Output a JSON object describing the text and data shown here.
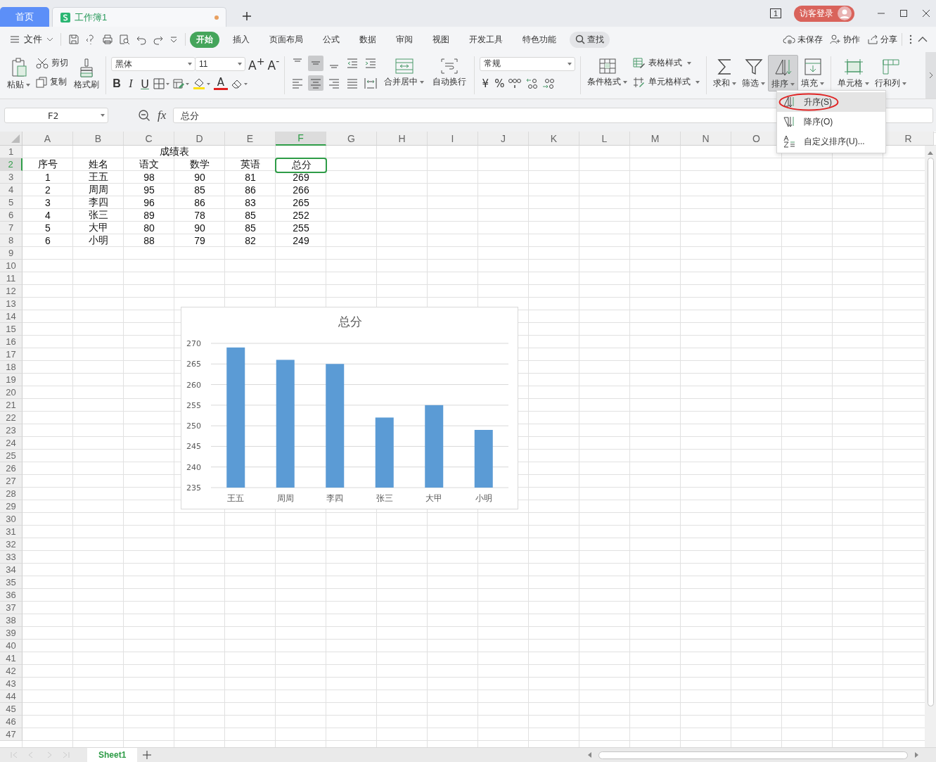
{
  "tabs": [
    {
      "label": "首页",
      "selected": false,
      "kind": "home",
      "unsaved": false
    },
    {
      "label": "工作簿1",
      "selected": true,
      "kind": "doc",
      "unsaved": true
    }
  ],
  "window_count": "1",
  "account": "访客登录",
  "menu": {
    "file": "文件",
    "tabs": [
      {
        "label": "开始",
        "selected": true
      },
      {
        "label": "插入",
        "selected": false
      },
      {
        "label": "页面布局",
        "selected": false
      },
      {
        "label": "公式",
        "selected": false
      },
      {
        "label": "数据",
        "selected": false
      },
      {
        "label": "审阅",
        "selected": false
      },
      {
        "label": "视图",
        "selected": false
      },
      {
        "label": "开发工具",
        "selected": false
      },
      {
        "label": "特色功能",
        "selected": false
      }
    ],
    "search": "查找",
    "actions": [
      "未保存",
      "协作",
      "分享"
    ]
  },
  "ribbon": {
    "paste": "粘贴",
    "cut": "剪切",
    "copy": "复制",
    "format_painter": "格式刷",
    "font": "黑体",
    "font_size": "11",
    "grow_font": "A$^{+}$",
    "shrink_font": "A$^{-}$",
    "bold": "B",
    "italic": "I",
    "underline": "U",
    "font_color": "A",
    "valign": [
      {
        "selected": false
      },
      {
        "selected": true
      },
      {
        "selected": false
      }
    ],
    "halign": [
      {
        "selected": false
      },
      {
        "selected": true
      },
      {
        "selected": false
      },
      {
        "selected": false
      }
    ],
    "merge_center": "合并居中",
    "wrap_text": "自动换行",
    "number_format": "常规",
    "currency": "¥",
    "percent": "%",
    "conditional_format": "条件格式",
    "table_style": "表格样式",
    "cell_style": "单元格样式",
    "sum": "求和",
    "filter": "筛选",
    "sort": {
      "label": "排序",
      "selected": true
    },
    "fill": "填充",
    "cell": "单元格",
    "rows_cols": "行和列"
  },
  "formula_bar": {
    "name_box": "F2",
    "fx": "fx",
    "formula": "总分"
  },
  "sheet": {
    "columns": [
      {
        "label": "A",
        "selected": false
      },
      {
        "label": "B",
        "selected": false
      },
      {
        "label": "C",
        "selected": false
      },
      {
        "label": "D",
        "selected": false
      },
      {
        "label": "E",
        "selected": false
      },
      {
        "label": "F",
        "selected": true
      },
      {
        "label": "G",
        "selected": false
      },
      {
        "label": "H",
        "selected": false
      },
      {
        "label": "I",
        "selected": false
      },
      {
        "label": "J",
        "selected": false
      },
      {
        "label": "K",
        "selected": false
      },
      {
        "label": "L",
        "selected": false
      },
      {
        "label": "M",
        "selected": false
      },
      {
        "label": "N",
        "selected": false
      },
      {
        "label": "O",
        "selected": false
      },
      {
        "label": "R",
        "selected": false
      }
    ],
    "row_numbers": [
      {
        "label": "1",
        "selected": false
      },
      {
        "label": "2",
        "selected": true
      },
      {
        "label": "3",
        "selected": false
      },
      {
        "label": "4",
        "selected": false
      },
      {
        "label": "5",
        "selected": false
      },
      {
        "label": "6",
        "selected": false
      },
      {
        "label": "7",
        "selected": false
      },
      {
        "label": "8",
        "selected": false
      },
      {
        "label": "9",
        "selected": false
      },
      {
        "label": "10",
        "selected": false
      },
      {
        "label": "11",
        "selected": false
      },
      {
        "label": "12",
        "selected": false
      },
      {
        "label": "13",
        "selected": false
      },
      {
        "label": "14",
        "selected": false
      },
      {
        "label": "15",
        "selected": false
      },
      {
        "label": "16",
        "selected": false
      },
      {
        "label": "17",
        "selected": false
      },
      {
        "label": "18",
        "selected": false
      },
      {
        "label": "19",
        "selected": false
      },
      {
        "label": "20",
        "selected": false
      },
      {
        "label": "21",
        "selected": false
      },
      {
        "label": "22",
        "selected": false
      },
      {
        "label": "23",
        "selected": false
      },
      {
        "label": "24",
        "selected": false
      },
      {
        "label": "25",
        "selected": false
      },
      {
        "label": "26",
        "selected": false
      },
      {
        "label": "27",
        "selected": false
      },
      {
        "label": "28",
        "selected": false
      },
      {
        "label": "29",
        "selected": false
      },
      {
        "label": "30",
        "selected": false
      },
      {
        "label": "31",
        "selected": false
      },
      {
        "label": "32",
        "selected": false
      },
      {
        "label": "33",
        "selected": false
      },
      {
        "label": "34",
        "selected": false
      },
      {
        "label": "35",
        "selected": false
      },
      {
        "label": "36",
        "selected": false
      },
      {
        "label": "37",
        "selected": false
      },
      {
        "label": "38",
        "selected": false
      },
      {
        "label": "39",
        "selected": false
      },
      {
        "label": "40",
        "selected": false
      },
      {
        "label": "41",
        "selected": false
      },
      {
        "label": "42",
        "selected": false
      },
      {
        "label": "43",
        "selected": false
      },
      {
        "label": "44",
        "selected": false
      },
      {
        "label": "45",
        "selected": false
      },
      {
        "label": "46",
        "selected": false
      },
      {
        "label": "47",
        "selected": false
      }
    ],
    "data": [
      {
        "kind": "title",
        "text": "成绩表"
      },
      {
        "kind": "cells",
        "cells": [
          {
            "text": "序号",
            "selected": false
          },
          {
            "text": "姓名",
            "selected": false
          },
          {
            "text": "语文",
            "selected": false
          },
          {
            "text": "数学",
            "selected": false
          },
          {
            "text": "英语",
            "selected": false
          },
          {
            "text": "总分",
            "selected": true
          }
        ]
      },
      {
        "kind": "cells",
        "cells": [
          {
            "text": "1",
            "selected": false
          },
          {
            "text": "王五",
            "selected": false
          },
          {
            "text": "98",
            "selected": false
          },
          {
            "text": "90",
            "selected": false
          },
          {
            "text": "81",
            "selected": false
          },
          {
            "text": "269",
            "selected": false
          }
        ]
      },
      {
        "kind": "cells",
        "cells": [
          {
            "text": "2",
            "selected": false
          },
          {
            "text": "周周",
            "selected": false
          },
          {
            "text": "95",
            "selected": false
          },
          {
            "text": "85",
            "selected": false
          },
          {
            "text": "86",
            "selected": false
          },
          {
            "text": "266",
            "selected": false
          }
        ]
      },
      {
        "kind": "cells",
        "cells": [
          {
            "text": "3",
            "selected": false
          },
          {
            "text": "李四",
            "selected": false
          },
          {
            "text": "96",
            "selected": false
          },
          {
            "text": "86",
            "selected": false
          },
          {
            "text": "83",
            "selected": false
          },
          {
            "text": "265",
            "selected": false
          }
        ]
      },
      {
        "kind": "cells",
        "cells": [
          {
            "text": "4",
            "selected": false
          },
          {
            "text": "张三",
            "selected": false
          },
          {
            "text": "89",
            "selected": false
          },
          {
            "text": "78",
            "selected": false
          },
          {
            "text": "85",
            "selected": false
          },
          {
            "text": "252",
            "selected": false
          }
        ]
      },
      {
        "kind": "cells",
        "cells": [
          {
            "text": "5",
            "selected": false
          },
          {
            "text": "大甲",
            "selected": false
          },
          {
            "text": "80",
            "selected": false
          },
          {
            "text": "90",
            "selected": false
          },
          {
            "text": "85",
            "selected": false
          },
          {
            "text": "255",
            "selected": false
          }
        ]
      },
      {
        "kind": "cells",
        "cells": [
          {
            "text": "6",
            "selected": false
          },
          {
            "text": "小明",
            "selected": false
          },
          {
            "text": "88",
            "selected": false
          },
          {
            "text": "79",
            "selected": false
          },
          {
            "text": "82",
            "selected": false
          },
          {
            "text": "249",
            "selected": false
          }
        ]
      }
    ],
    "chart_data": {
      "type": "bar",
      "title": "总分",
      "categories": [
        "王五",
        "周周",
        "李四",
        "张三",
        "大甲",
        "小明"
      ],
      "series": [
        {
          "color": "#5b9bd5",
          "values": [
            269,
            266,
            265,
            252,
            255,
            249
          ]
        }
      ],
      "ylim": [
        235,
        270
      ],
      "yticks": [
        235,
        240,
        245,
        250,
        255,
        260,
        265,
        270
      ],
      "grid": true
    }
  },
  "sort_menu": [
    {
      "label": "升序(S)",
      "selected": true,
      "circled": true
    },
    {
      "label": "降序(O)",
      "selected": false,
      "circled": false
    },
    {
      "label": "自定义排序(U)...",
      "selected": false,
      "circled": false
    }
  ],
  "sheet_tabs": [
    {
      "label": "Sheet1",
      "selected": true
    }
  ]
}
